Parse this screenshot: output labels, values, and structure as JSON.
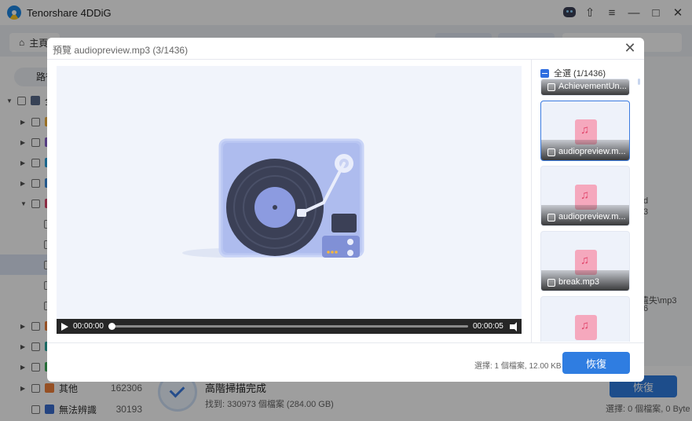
{
  "app": {
    "title": "Tenorshare 4DDiG",
    "home_tab": "主頁",
    "path_label": "路徑",
    "tree_root": "全",
    "tree_other": {
      "label": "其他",
      "count": "162306"
    },
    "tree_last": {
      "label": "無法辨識",
      "count": "30193"
    },
    "colors": {
      "accent": "#2f7de1"
    }
  },
  "background_status": {
    "scan_title": "高階掃描完成",
    "found": "找到: 330973 個檔案 (284.00 GB)",
    "recover_label": "恢復",
    "selected": "選擇: 0 個檔案, 0 Byte",
    "frag1": "d",
    "frag2": "3",
    "frag3": "遺失\\mp3",
    "frag4": "6"
  },
  "dialog": {
    "title": "預覽 audiopreview.mp3 (3/1436)",
    "player": {
      "current_time": "00:00:00",
      "end_time": "00:00:05",
      "progress": 0
    },
    "select_all": "全選 (1/1436)",
    "files": [
      {
        "name": "AchievementUn...",
        "checked": false
      },
      {
        "name": "audiopreview.m...",
        "checked": false,
        "active": true
      },
      {
        "name": "audiopreview.m...",
        "checked": false
      },
      {
        "name": "break.mp3",
        "checked": false
      },
      {
        "name": "",
        "checked": false
      }
    ],
    "selection_info": "選擇: 1 個檔案, 12.00 KB",
    "recover_label": "恢復"
  }
}
